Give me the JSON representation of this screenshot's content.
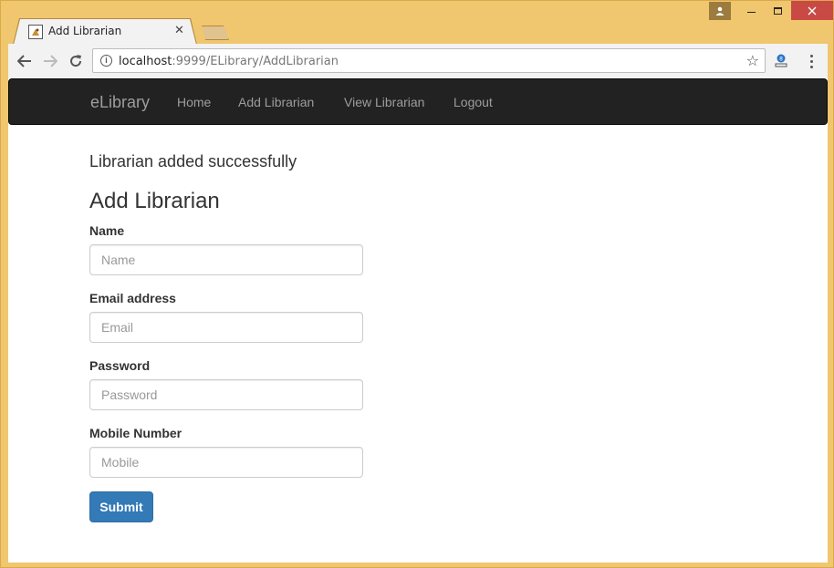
{
  "browser": {
    "tab_title": "Add Librarian",
    "tab_close": "✕",
    "url_host": "localhost",
    "url_path": ":9999/ELibrary/AddLibrarian"
  },
  "navbar": {
    "brand": "eLibrary",
    "links": [
      "Home",
      "Add Librarian",
      "View Librarian",
      "Logout"
    ]
  },
  "main": {
    "success_message": "Librarian added successfully",
    "form_title": "Add Librarian",
    "fields": [
      {
        "label": "Name",
        "placeholder": "Name",
        "value": ""
      },
      {
        "label": "Email address",
        "placeholder": "Email",
        "value": ""
      },
      {
        "label": "Password",
        "placeholder": "Password",
        "value": ""
      },
      {
        "label": "Mobile Number",
        "placeholder": "Mobile",
        "value": ""
      }
    ],
    "submit_label": "Submit"
  },
  "colors": {
    "frame": "#f0c66e",
    "navbar_bg": "#222222",
    "primary_button": "#337ab7",
    "close_button": "#c94a45"
  }
}
